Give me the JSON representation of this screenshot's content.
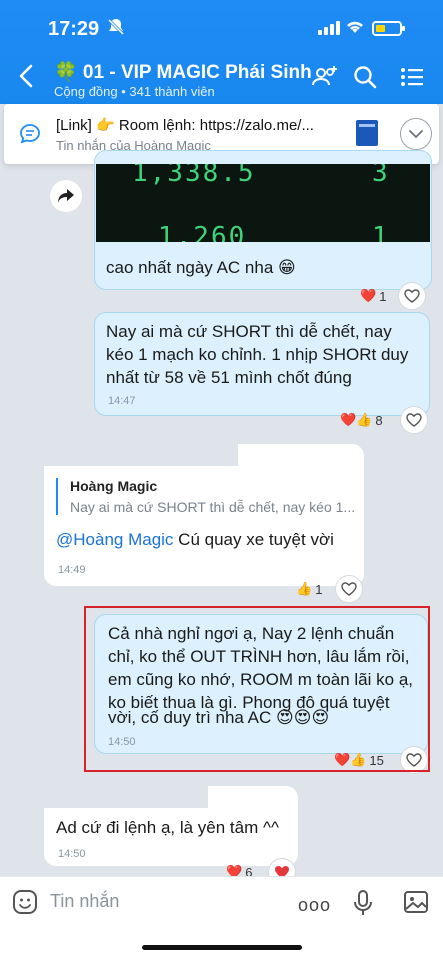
{
  "status_bar": {
    "time": "17:29"
  },
  "header": {
    "title": "🍀 01 - VIP MAGIC Phái Sinh",
    "subtitle": "Cộng đồng • 341 thành viên"
  },
  "pinned": {
    "title": "[Link] 👉 Room lệnh: https://zalo.me/...",
    "subtitle": "Tin nhắn của Hoàng Magic"
  },
  "chart_image": {
    "numbers": [
      "1,338.5",
      "1,260",
      "3",
      "1"
    ]
  },
  "messages": [
    {
      "id": "m1",
      "text": "cao nhất ngày AC nha 😁",
      "reactions": {
        "emojis": "❤️",
        "count": "1"
      }
    },
    {
      "id": "m2",
      "lines": [
        "Nay ai mà cứ SHORT thì dễ chết,  nay",
        "kéo 1 mạch ko chỉnh. 1 nhịp SHORt duy",
        "nhất từ 58 về 51 mình chốt đúng"
      ],
      "time": "14:47",
      "reactions": {
        "emojis": "❤️👍",
        "count": "8"
      }
    },
    {
      "id": "m3",
      "quote_name": "Hoàng Magic",
      "quote_text": "Nay ai mà cứ SHORT thì dễ chết,  nay kéo 1...",
      "mention": "@Hoàng Magic",
      "text": " Cú quay xe tuyệt vời",
      "time": "14:49",
      "reactions": {
        "emojis": "👍",
        "count": "1"
      }
    },
    {
      "id": "m4",
      "lines": [
        "Cả nhà nghỉ ngơi ạ, Nay 2 lệnh chuẩn",
        "chỉ, ko thể OUT TRÌNH hơn, lâu lắm rồi,",
        "em cũng ko nhớ, ROOM m toàn lãi ko ạ,",
        "ko biết thua là gì. Phong đô quá tuyệt",
        "vời, cố duy trì nha AC 😍😍😍"
      ],
      "time": "14:50",
      "reactions": {
        "emojis": "❤️👍",
        "count": "15"
      }
    },
    {
      "id": "m5",
      "text": "Ad cứ đi lệnh ạ, là yên tâm ^^",
      "time": "14:50",
      "reactions": {
        "emojis": "❤️",
        "count": "6"
      }
    }
  ],
  "input": {
    "placeholder": "Tin nhắn",
    "more": "ooo"
  },
  "colors": {
    "header": "#1f8cf5",
    "my_bubble": "#dcf1fd",
    "highlight": "#d6232a"
  }
}
